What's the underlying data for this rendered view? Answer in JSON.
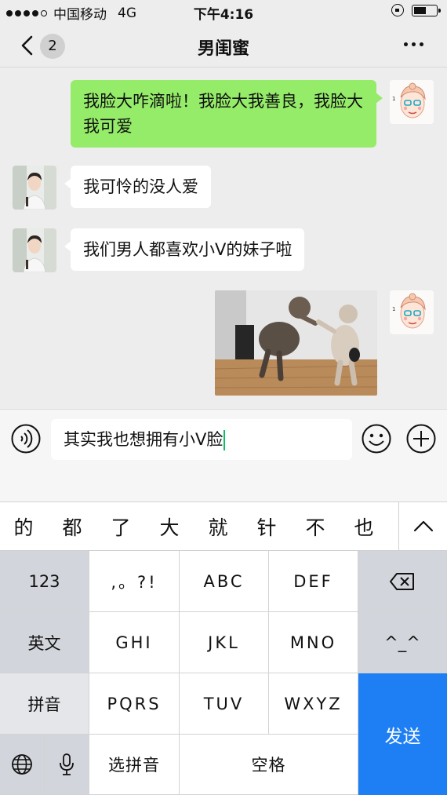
{
  "status_bar": {
    "carrier": "中国移动",
    "network": "4G",
    "time": "下午4:16"
  },
  "nav": {
    "unread_count": "2",
    "title": "男闺蜜"
  },
  "messages": [
    {
      "side": "right",
      "type": "text",
      "text": "我脸大咋滴啦！我脸大我善良，我脸大我可爱"
    },
    {
      "side": "left",
      "type": "text",
      "text": "我可怜的没人爱"
    },
    {
      "side": "left",
      "type": "text",
      "text": "我们男人都喜欢小V的妹子啦"
    },
    {
      "side": "right",
      "type": "image",
      "image": "fighting-cats"
    }
  ],
  "input": {
    "value": "其实我也想拥有小V脸"
  },
  "candidates": [
    "的",
    "都",
    "了",
    "大",
    "就",
    "针",
    "不",
    "也"
  ],
  "keyboard": {
    "row1": [
      "123",
      ",。?!",
      "ABC",
      "DEF"
    ],
    "row2": [
      "英文",
      "GHI",
      "JKL",
      "MNO",
      "^_^"
    ],
    "row3": [
      "拼音",
      "PQRS",
      "TUV",
      "WXYZ"
    ],
    "row4": [
      "选拼音",
      "空格"
    ],
    "send": "发送"
  },
  "colors": {
    "my_bubble": "#95ec69",
    "send_key": "#1e7ff4",
    "background": "#ededed"
  }
}
